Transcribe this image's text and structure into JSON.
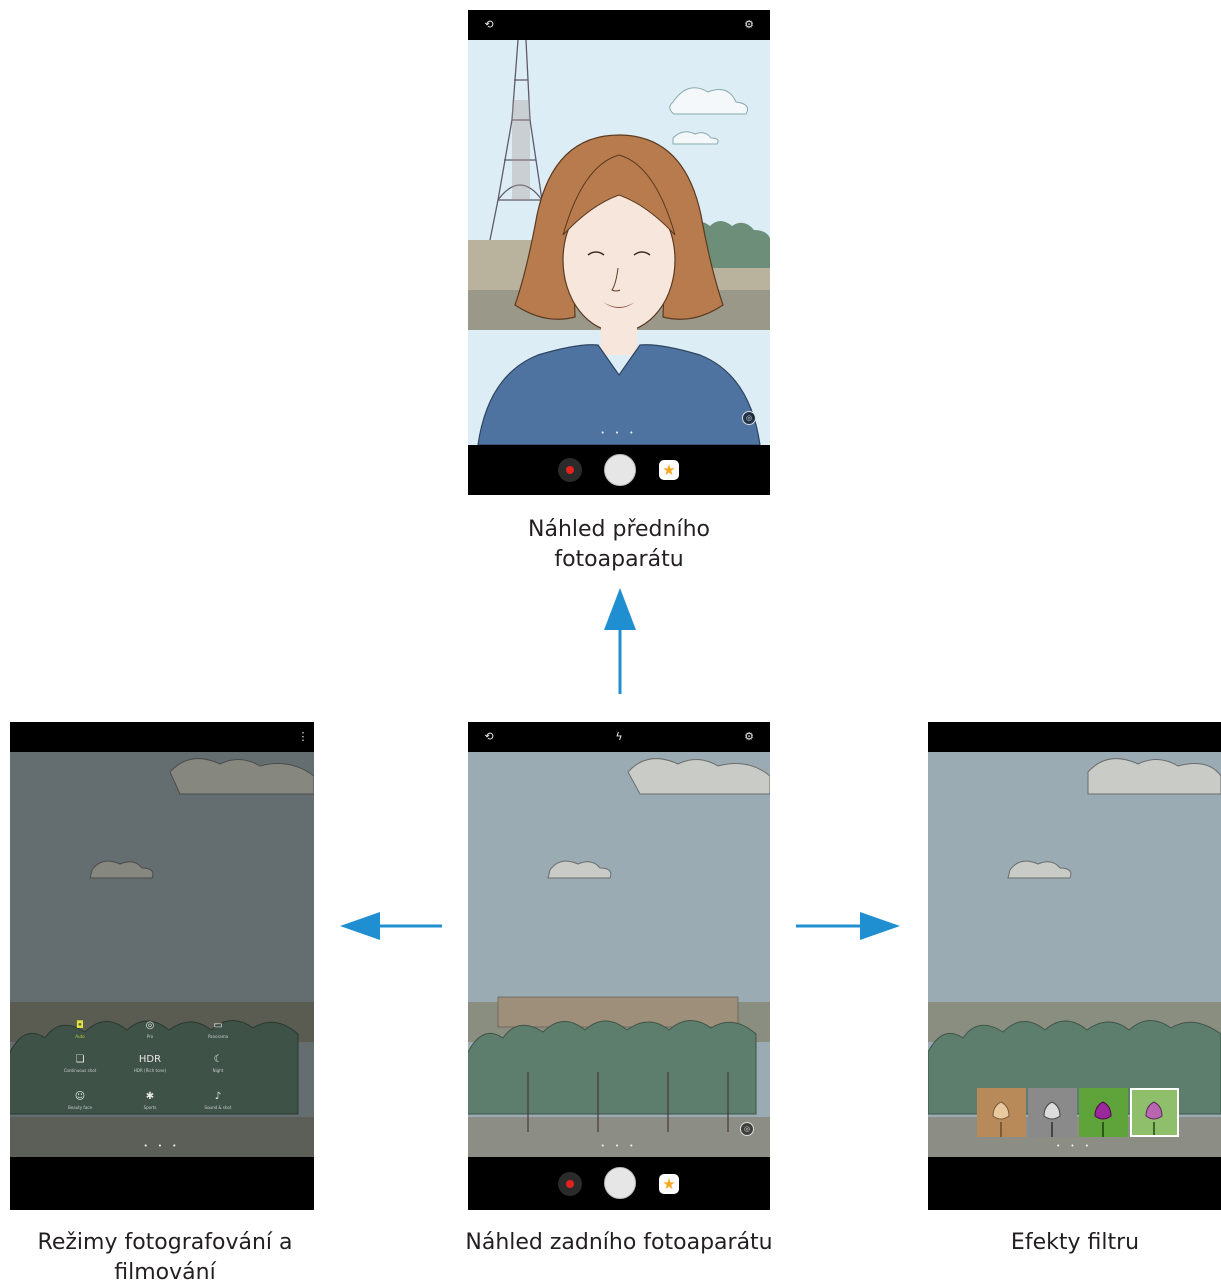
{
  "captions": {
    "front_preview": "Náhled předního fotoaparátu",
    "rear_preview": "Náhled zadního fotoaparátu",
    "shooting_modes": "Režimy fotografování a filmování",
    "filter_effects": "Efekty filtru"
  },
  "colors": {
    "arrow": "#1f8fd1",
    "sky": "#d9ecf5",
    "rear_sky": "#9aabb4",
    "record": "#e3231b",
    "active_mode": "#dfe33b"
  },
  "screens": {
    "front": {
      "icons": [
        "camera-switch-icon",
        "settings-icon"
      ],
      "page_dots": "• • •"
    },
    "rear": {
      "icons": [
        "camera-switch-icon",
        "flash-off-icon",
        "settings-icon"
      ],
      "page_dots": "• • •"
    },
    "modes": {
      "icons": [
        "more-options-icon"
      ],
      "page_dots": "• • •",
      "items": [
        {
          "icon": "camera-icon",
          "glyph": "◘",
          "label": "Auto"
        },
        {
          "icon": "pro-icon",
          "glyph": "◎",
          "label": "Pro"
        },
        {
          "icon": "panorama-icon",
          "glyph": "▭",
          "label": "Panorama"
        },
        {
          "icon": "continuous-shot-icon",
          "glyph": "❏",
          "label": "Continuous shot"
        },
        {
          "icon": "hdr-icon",
          "glyph": "HDR",
          "label": "HDR (Rich tone)"
        },
        {
          "icon": "night-icon",
          "glyph": "☾",
          "label": "Night"
        },
        {
          "icon": "beauty-face-icon",
          "glyph": "☺",
          "label": "Beauty face"
        },
        {
          "icon": "sports-icon",
          "glyph": "✱",
          "label": "Sports"
        },
        {
          "icon": "sound-shot-icon",
          "glyph": "♪",
          "label": "Sound & shot"
        }
      ]
    },
    "filters": {
      "page_dots": "• • •",
      "thumbnails": [
        "sepia-filter",
        "grayscale-filter",
        "vivid-filter",
        "original-filter"
      ]
    }
  }
}
